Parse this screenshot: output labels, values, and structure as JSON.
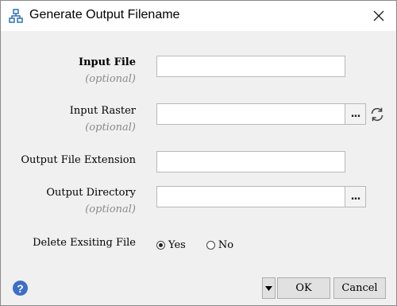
{
  "window": {
    "title": "Generate Output Filename",
    "icon": "network-tree-icon",
    "close_icon": "close-icon"
  },
  "form": {
    "input_file": {
      "label": "Input File",
      "hint": "(optional)",
      "value": ""
    },
    "input_raster": {
      "label": "Input Raster",
      "hint": "(optional)",
      "value": "",
      "browse_label": "...",
      "refresh_icon": "refresh-icon"
    },
    "output_extension": {
      "label": "Output File Extension",
      "value": ""
    },
    "output_directory": {
      "label": "Output Directory",
      "hint": "(optional)",
      "value": "",
      "browse_label": "..."
    },
    "delete_existing": {
      "label": "Delete Exsiting File",
      "options": [
        {
          "label": "Yes",
          "selected": true
        },
        {
          "label": "No",
          "selected": false
        }
      ]
    }
  },
  "footer": {
    "help_icon": "help-icon",
    "help_glyph": "?",
    "dropdown_icon": "triangle-down-icon",
    "ok_label": "OK",
    "cancel_label": "Cancel"
  }
}
